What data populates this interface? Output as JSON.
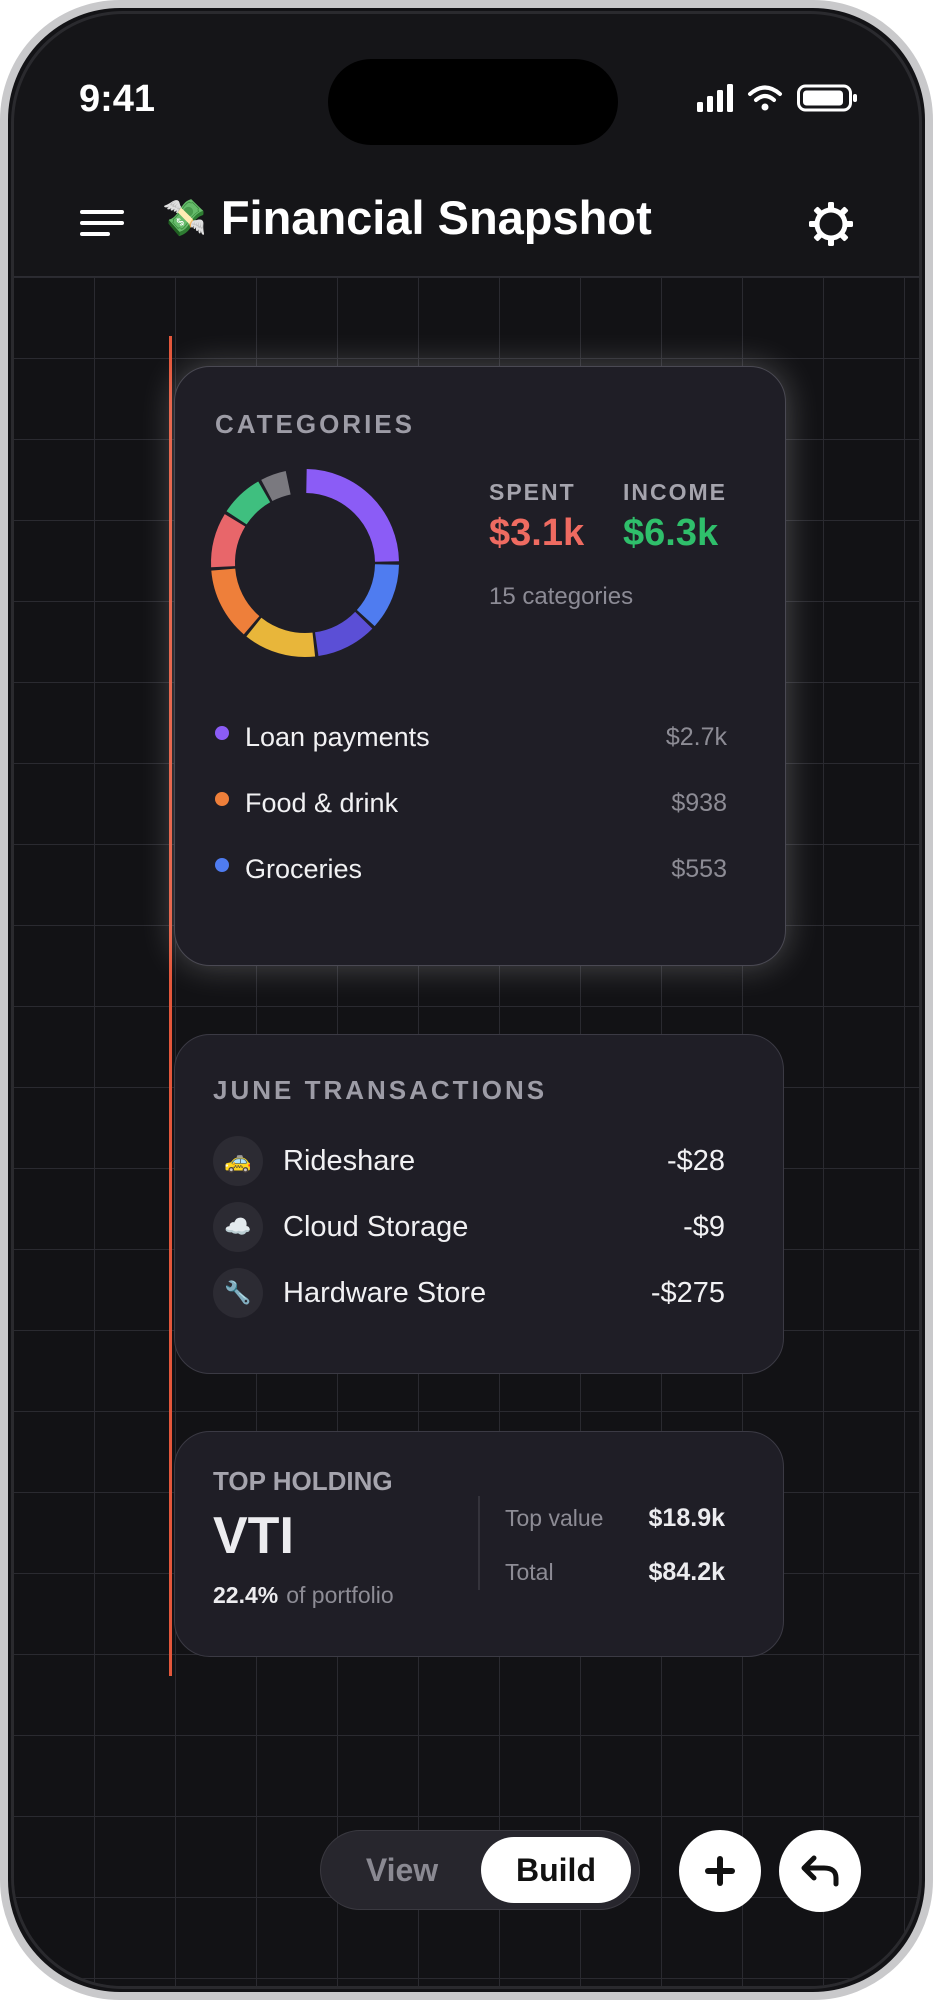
{
  "status_bar": {
    "time": "9:41"
  },
  "header": {
    "title_emoji": "💸",
    "title": "Financial Snapshot"
  },
  "categories_card": {
    "label": "CATEGORIES",
    "spent_label": "SPENT",
    "spent_value": "$3.1k",
    "income_label": "INCOME",
    "income_value": "$6.3k",
    "count_text": "15 categories",
    "donut_segments": [
      {
        "color": "#8b5cf6",
        "fraction": 0.25
      },
      {
        "color": "#4f7cf0",
        "fraction": 0.12
      },
      {
        "color": "#5b4fd6",
        "fraction": 0.11
      },
      {
        "color": "#e8b63a",
        "fraction": 0.13
      },
      {
        "color": "#ee7f3a",
        "fraction": 0.13
      },
      {
        "color": "#e8666a",
        "fraction": 0.1
      },
      {
        "color": "#3fbf7f",
        "fraction": 0.08
      },
      {
        "color": "#7a797f",
        "fraction": 0.05
      }
    ],
    "items": [
      {
        "name": "Loan payments",
        "amount": "$2.7k",
        "color": "#8b5cf6"
      },
      {
        "name": "Food & drink",
        "amount": "$938",
        "color": "#ee7f3a"
      },
      {
        "name": "Groceries",
        "amount": "$553",
        "color": "#4f7cf0"
      }
    ]
  },
  "transactions_card": {
    "label": "JUNE TRANSACTIONS",
    "items": [
      {
        "icon": "🚕",
        "name": "Rideshare",
        "amount": "-$28"
      },
      {
        "icon": "☁️",
        "name": "Cloud Storage",
        "amount": "-$9"
      },
      {
        "icon": "🔧",
        "name": "Hardware Store",
        "amount": "-$275"
      }
    ]
  },
  "holding_card": {
    "label": "TOP HOLDING",
    "ticker": "VTI",
    "pct": "22.4%",
    "pct_suffix": "of portfolio",
    "top_value_label": "Top value",
    "top_value": "$18.9k",
    "total_label": "Total",
    "total": "$84.2k"
  },
  "toolbar": {
    "view_label": "View",
    "build_label": "Build",
    "active_mode": "Build"
  },
  "colors": {
    "accent_red": "#e3573b",
    "spent": "#ef6b61",
    "income": "#2fbf6b"
  }
}
